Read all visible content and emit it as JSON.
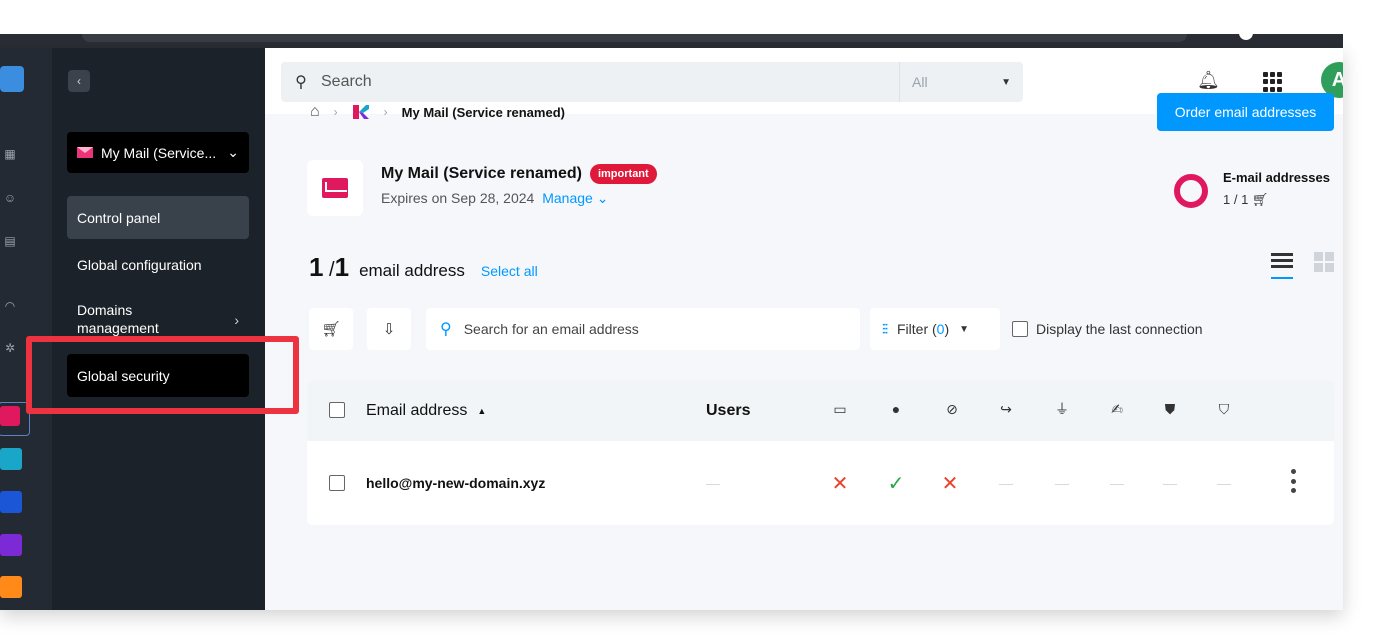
{
  "header": {
    "search_placeholder": "Search",
    "search_scope": "All",
    "avatar_initial": "A"
  },
  "sidebar": {
    "service_select": "My Mail (Service...",
    "items": [
      {
        "label": "Control panel",
        "active": true
      },
      {
        "label": "Global configuration"
      },
      {
        "label": "Domains management"
      },
      {
        "label": "Global security"
      }
    ]
  },
  "breadcrumb": {
    "current": "My Mail (Service renamed)"
  },
  "actions": {
    "order_label": "Order email addresses"
  },
  "service": {
    "title": "My Mail (Service renamed)",
    "badge": "important",
    "expires": "Expires on Sep 28, 2024",
    "manage": "Manage"
  },
  "email_quota": {
    "label": "E-mail addresses",
    "value": "1 / 1"
  },
  "list": {
    "count": "1",
    "total": "1",
    "label": "email address",
    "select_all": "Select all",
    "search_placeholder": "Search for an email address",
    "filter_label": "Filter (",
    "filter_count": "0",
    "filter_close": ")",
    "last_connection": "Display the last connection"
  },
  "table": {
    "col_email": "Email address",
    "col_users": "Users",
    "rows": [
      {
        "email": "hello@my-new-domain.xyz",
        "users": "—"
      }
    ]
  },
  "colors": {
    "accent": "#0098ff",
    "brand_pink": "#e0195f",
    "error": "#e8432b",
    "success": "#23a94a",
    "highlight": "#ee3340"
  }
}
